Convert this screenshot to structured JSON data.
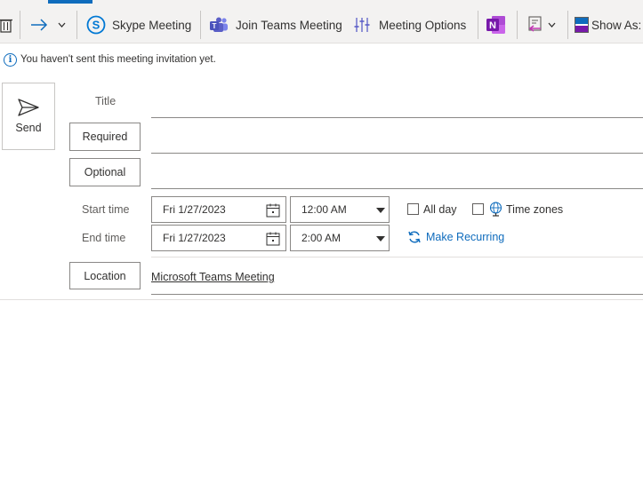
{
  "toolbar": {
    "skype_label": "Skype Meeting",
    "teams_label": "Join Teams Meeting",
    "options_label": "Meeting Options",
    "showas_label": "Show As:"
  },
  "infobar": {
    "text": "You haven't sent this meeting invitation yet."
  },
  "send": {
    "label": "Send"
  },
  "fields": {
    "title_label": "Title",
    "required_label": "Required",
    "optional_label": "Optional",
    "location_label": "Location",
    "location_value": "Microsoft Teams Meeting"
  },
  "times": {
    "start_label": "Start time",
    "end_label": "End time",
    "start_date": "Fri 1/27/2023",
    "start_time": "12:00 AM",
    "end_date": "Fri 1/27/2023",
    "end_time": "2:00 AM",
    "all_day_label": "All day",
    "all_day_checked": false,
    "time_zones_label": "Time zones",
    "time_zones_checked": false,
    "make_recurring_label": "Make Recurring"
  },
  "colors": {
    "accent": "#0f6cbd",
    "teams": "#5b5fc7",
    "onenote": "#7719aa",
    "skype": "#0078d4"
  }
}
